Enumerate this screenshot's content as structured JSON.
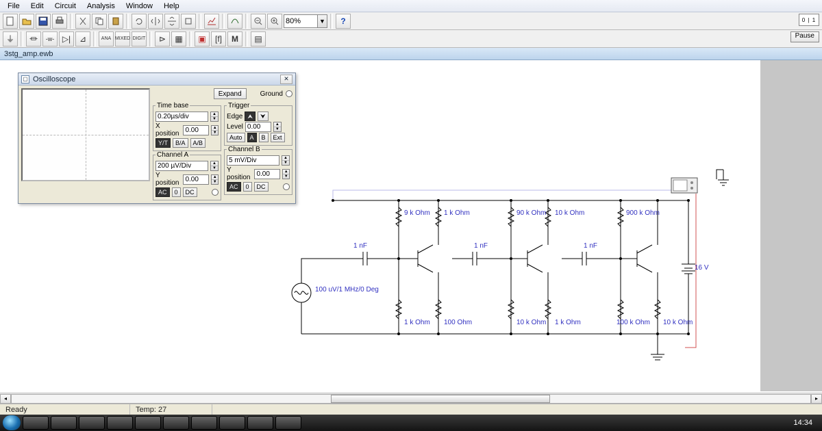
{
  "menu": {
    "items": [
      "File",
      "Edit",
      "Circuit",
      "Analysis",
      "Window",
      "Help"
    ]
  },
  "toolbar1": {
    "zoom_value": "80%",
    "help_label": "?"
  },
  "right": {
    "switch_label": "0 | 1",
    "pause_label": "Pause"
  },
  "document": {
    "filename": "3stg_amp.ewb"
  },
  "scope": {
    "title": "Oscilloscope",
    "close": "✕",
    "expand_label": "Expand",
    "ground_label": "Ground",
    "timebase": {
      "legend": "Time base",
      "scale": "0.20µs/div",
      "xpos_label": "X position",
      "xpos": "0.00",
      "mode_yt": "Y/T",
      "mode_ba": "B/A",
      "mode_ab": "A/B"
    },
    "trigger": {
      "legend": "Trigger",
      "edge_label": "Edge",
      "level_label": "Level",
      "level": "0.00",
      "auto": "Auto",
      "a": "A",
      "b": "B",
      "ext": "Ext"
    },
    "chA": {
      "legend": "Channel A",
      "scale": "200 µV/Div",
      "ypos_label": "Y position",
      "ypos": "0.00",
      "ac": "AC",
      "zero": "0",
      "dc": "DC"
    },
    "chB": {
      "legend": "Channel B",
      "scale": "5 mV/Div",
      "ypos_label": "Y position",
      "ypos": "0.00",
      "ac": "AC",
      "zero": "0",
      "dc": "DC"
    }
  },
  "circuit": {
    "source": "100 uV/1 MHz/0 Deg",
    "c1": "1 nF",
    "c2": "1 nF",
    "c3": "1 nF",
    "r_top1": "9 k Ohm",
    "r_top2": "1 k Ohm",
    "r_top3": "90 k Ohm",
    "r_top4": "10 k Ohm",
    "r_top5": "900 k Ohm",
    "r_bot1": "1 k Ohm",
    "r_bot2": "100  Ohm",
    "r_bot3": "10 k Ohm",
    "r_bot4": "1 k Ohm",
    "r_bot5": "100 k Ohm",
    "r_bot6": "10 k Ohm",
    "batt": "16 V"
  },
  "status": {
    "ready": "Ready",
    "temp_label": "Temp:",
    "temp": "27"
  },
  "taskbar": {
    "clock": "14:34"
  }
}
